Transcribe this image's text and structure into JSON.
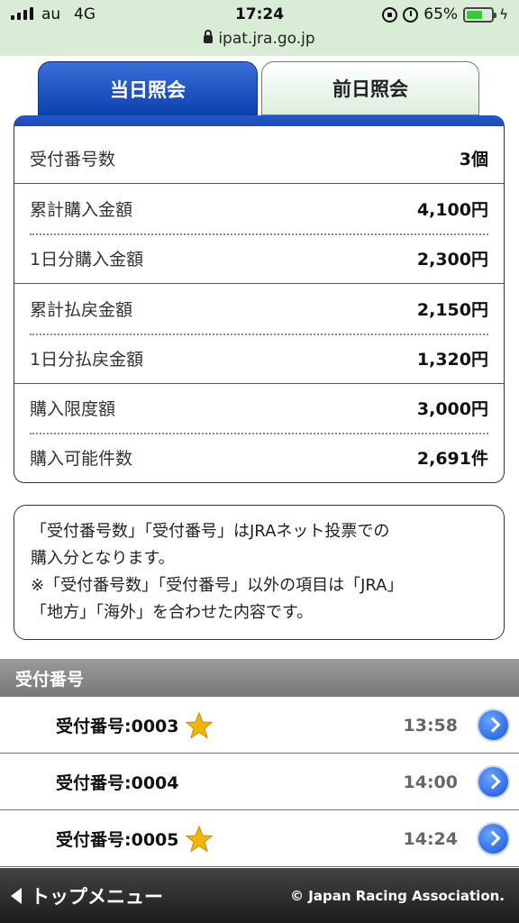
{
  "status": {
    "carrier": "au",
    "network": "4G",
    "time": "17:24",
    "battery": "65%",
    "battery_level": 0.65,
    "url": "ipat.jra.go.jp"
  },
  "tabs": {
    "today": "当日照会",
    "previous": "前日照会"
  },
  "summary": {
    "rows": [
      {
        "label": "受付番号数",
        "value": "3個"
      },
      {
        "label": "累計購入金額",
        "value": "4,100円"
      },
      {
        "label": "1日分購入金額",
        "value": "2,300円"
      },
      {
        "label": "累計払戻金額",
        "value": "2,150円"
      },
      {
        "label": "1日分払戻金額",
        "value": "1,320円"
      },
      {
        "label": "購入限度額",
        "value": "3,000円"
      },
      {
        "label": "購入可能件数",
        "value": "2,691件"
      }
    ]
  },
  "notice": {
    "line1": "「受付番号数」「受付番号」はJRAネット投票での",
    "line2": "購入分となります。",
    "line3": "※「受付番号数」「受付番号」以外の項目は「JRA」",
    "line4": "「地方」「海外」を合わせた内容です。"
  },
  "receipts": {
    "header": "受付番号",
    "items": [
      {
        "number": "受付番号:0003",
        "time": "13:58",
        "starred": true
      },
      {
        "number": "受付番号:0004",
        "time": "14:00",
        "starred": false
      },
      {
        "number": "受付番号:0005",
        "time": "14:24",
        "starred": true
      }
    ]
  },
  "footer": {
    "back_label": "トップメニュー",
    "copyright": "© Japan Racing Association."
  },
  "colors": {
    "tab_active": "#0b3fae",
    "status_bg": "#d9ecd6",
    "star": "#f5b400"
  }
}
